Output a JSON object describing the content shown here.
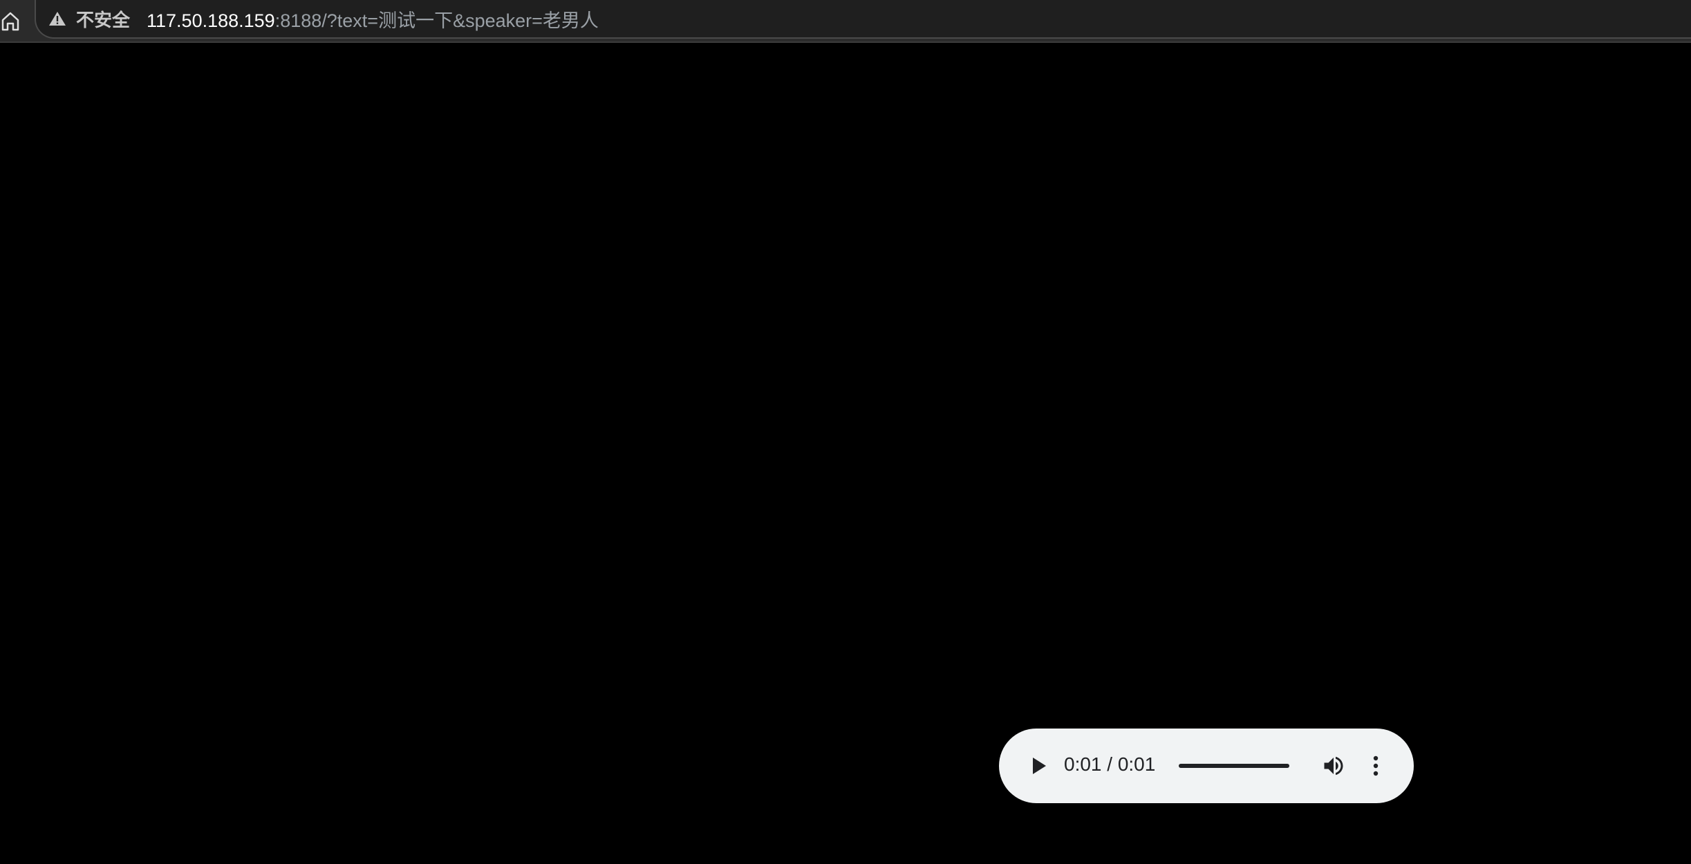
{
  "browser": {
    "security_label": "不安全",
    "url_host": "117.50.188.159",
    "url_rest": ":8188/?text=测试一下&speaker=老男人"
  },
  "audio_player": {
    "time_display": "0:01 / 0:01",
    "progress_fraction": 1.0,
    "icons": {
      "play": "play-icon",
      "volume": "volume-icon",
      "more": "more-vertical-icon"
    }
  },
  "colors": {
    "page_background": "#000000",
    "player_background": "#f1f3f4",
    "player_foreground": "#202124"
  }
}
